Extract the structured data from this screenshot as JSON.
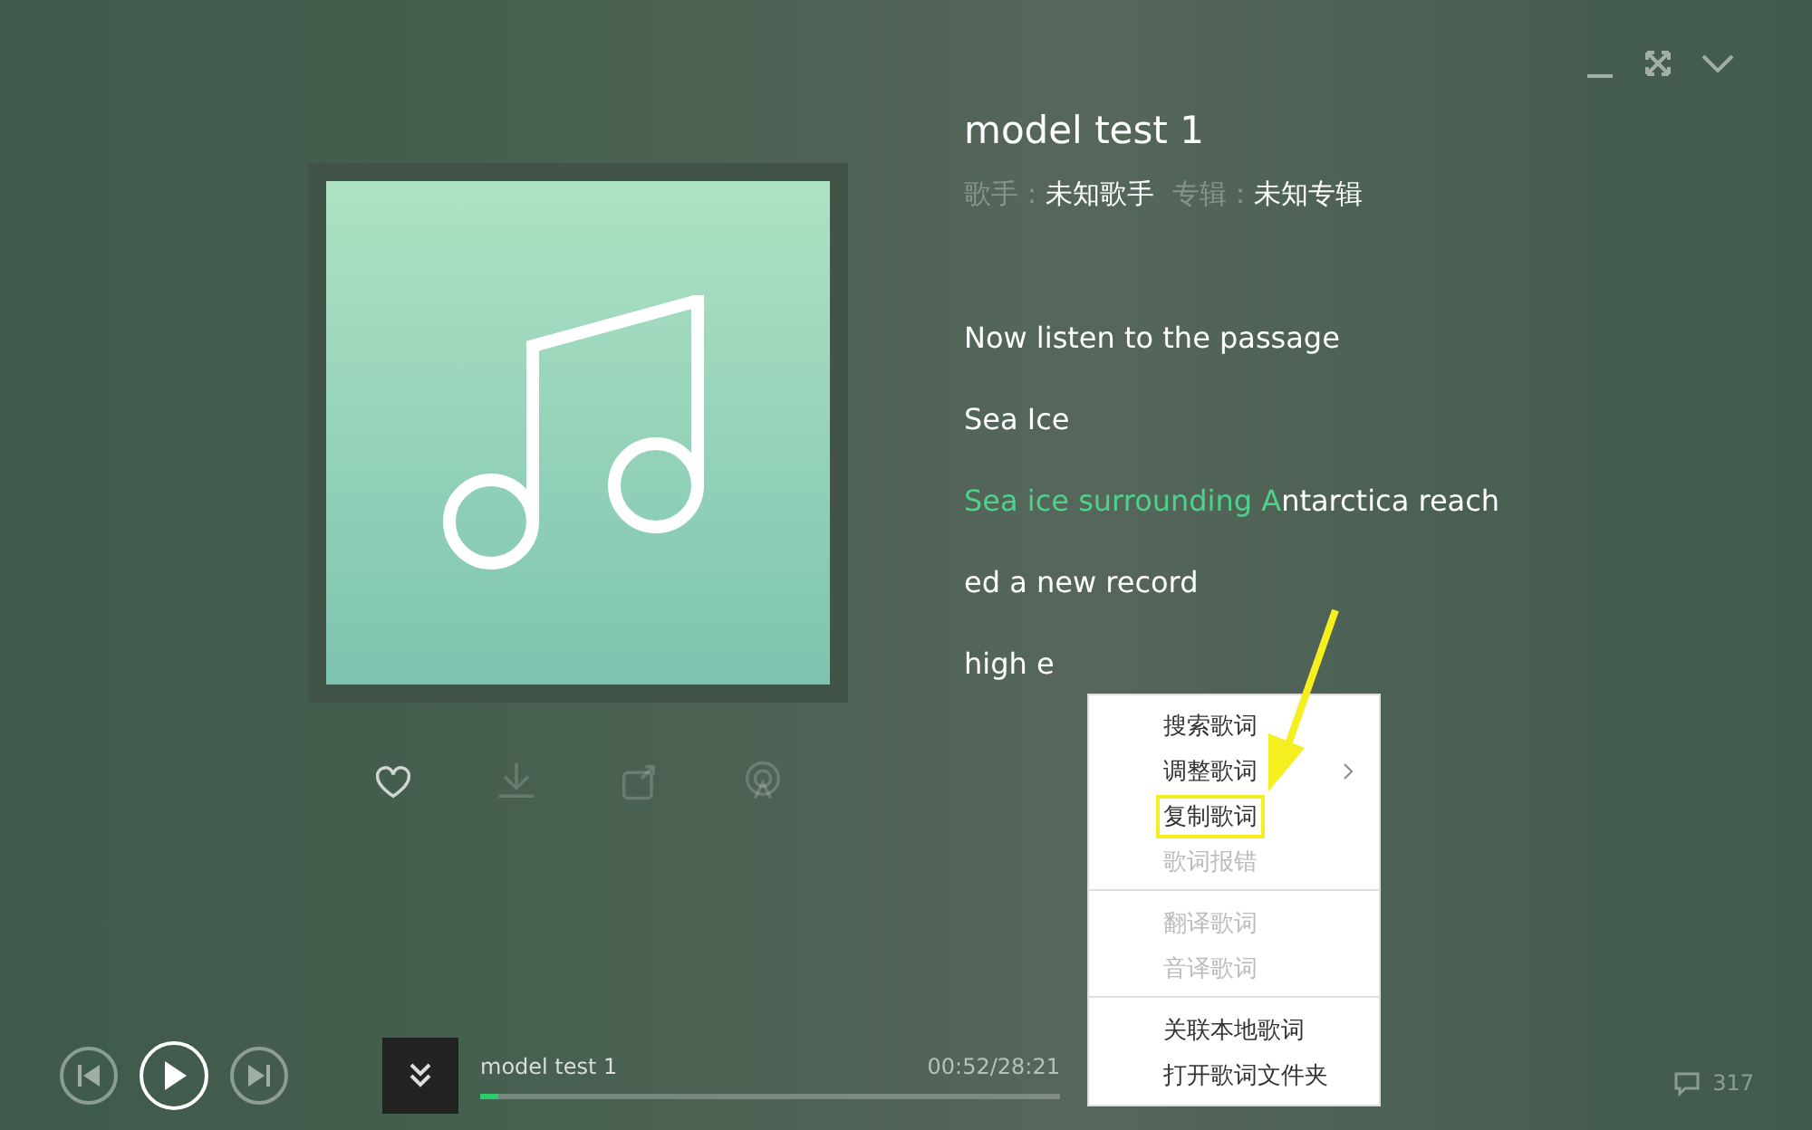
{
  "window_controls": [
    {
      "kind": "minimize"
    },
    {
      "kind": "fullscreen"
    },
    {
      "kind": "collapse"
    }
  ],
  "song": {
    "title": "model test 1",
    "artist_label": "歌手：",
    "artist": "未知歌手",
    "album_label": "专辑：",
    "album": "未知专辑"
  },
  "cover_actions": [
    {
      "kind": "like",
      "disabled": false
    },
    {
      "kind": "download",
      "disabled": true
    },
    {
      "kind": "share",
      "disabled": true
    },
    {
      "kind": "broadcast",
      "disabled": true
    }
  ],
  "lyrics": [
    {
      "rest": "Now listen to the passage"
    },
    {
      "rest": "Sea Ice"
    },
    {
      "sung": "Sea ice surrounding A",
      "rest": "ntarctica reach"
    },
    {
      "rest": "ed a new record"
    },
    {
      "rest": "high e"
    }
  ],
  "context_menu": [
    {
      "label": "搜索歌词",
      "disabled": false,
      "submenu": false,
      "highlighted": false
    },
    {
      "label": "调整歌词",
      "disabled": false,
      "submenu": true,
      "highlighted": false
    },
    {
      "label": "复制歌词",
      "disabled": false,
      "submenu": false,
      "highlighted": true
    },
    {
      "label": "歌词报错",
      "disabled": true,
      "submenu": false,
      "highlighted": false,
      "divider_after": true
    },
    {
      "label": "翻译歌词",
      "disabled": true,
      "submenu": false,
      "highlighted": false
    },
    {
      "label": "音译歌词",
      "disabled": true,
      "submenu": false,
      "highlighted": false,
      "divider_after": true
    },
    {
      "label": "关联本地歌词",
      "disabled": false,
      "submenu": false,
      "highlighted": false
    },
    {
      "label": "打开歌词文件夹",
      "disabled": false,
      "submenu": false,
      "highlighted": false
    }
  ],
  "player": {
    "playing": false,
    "track": "model test 1",
    "time": "00:52/28:21",
    "level": 0.03,
    "comment_count": "317"
  }
}
